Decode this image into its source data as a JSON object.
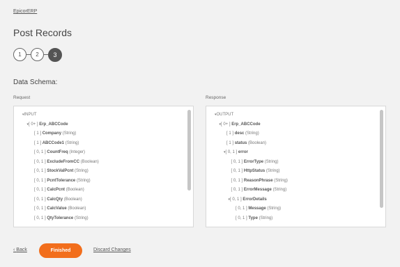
{
  "breadcrumb": "EpicorERP",
  "title": "Post Records",
  "steps": [
    "1",
    "2",
    "3"
  ],
  "current_step": "3",
  "section_title": "Data Schema:",
  "request": {
    "label": "Request",
    "nodes": [
      {
        "indent": 0,
        "toggle": "▾",
        "card": "",
        "name": "INPUT",
        "type": "",
        "bold": false
      },
      {
        "indent": 1,
        "toggle": "▾",
        "card": "[ 0+ ]",
        "name": "Erp_ABCCode",
        "type": "",
        "bold": true
      },
      {
        "indent": 2,
        "toggle": "",
        "card": "[ 1 ]",
        "name": "Company",
        "type": "(String)",
        "bold": true
      },
      {
        "indent": 2,
        "toggle": "",
        "card": "[ 1 ]",
        "name": "ABCCode1",
        "type": "(String)",
        "bold": true
      },
      {
        "indent": 2,
        "toggle": "",
        "card": "[ 0, 1 ]",
        "name": "CountFreq",
        "type": "(Integer)",
        "bold": true
      },
      {
        "indent": 2,
        "toggle": "",
        "card": "[ 0, 1 ]",
        "name": "ExcludeFromCC",
        "type": "(Boolean)",
        "bold": true
      },
      {
        "indent": 2,
        "toggle": "",
        "card": "[ 0, 1 ]",
        "name": "StockValPcnt",
        "type": "(String)",
        "bold": true
      },
      {
        "indent": 2,
        "toggle": "",
        "card": "[ 0, 1 ]",
        "name": "PcntTolerance",
        "type": "(String)",
        "bold": true
      },
      {
        "indent": 2,
        "toggle": "",
        "card": "[ 0, 1 ]",
        "name": "CalcPcnt",
        "type": "(Boolean)",
        "bold": true
      },
      {
        "indent": 2,
        "toggle": "",
        "card": "[ 0, 1 ]",
        "name": "CalcQty",
        "type": "(Boolean)",
        "bold": true
      },
      {
        "indent": 2,
        "toggle": "",
        "card": "[ 0, 1 ]",
        "name": "CalcValue",
        "type": "(Boolean)",
        "bold": true
      },
      {
        "indent": 2,
        "toggle": "",
        "card": "[ 0, 1 ]",
        "name": "QtyTolerance",
        "type": "(String)",
        "bold": true
      }
    ]
  },
  "response": {
    "label": "Response",
    "nodes": [
      {
        "indent": 0,
        "toggle": "▾",
        "card": "",
        "name": "OUTPUT",
        "type": "",
        "bold": false
      },
      {
        "indent": 1,
        "toggle": "▾",
        "card": "[ 0+ ]",
        "name": "Erp_ABCCode",
        "type": "",
        "bold": true
      },
      {
        "indent": 2,
        "toggle": "",
        "card": "[ 1 ]",
        "name": "desc",
        "type": "(String)",
        "bold": true
      },
      {
        "indent": 2,
        "toggle": "",
        "card": "[ 1 ]",
        "name": "status",
        "type": "(Boolean)",
        "bold": true
      },
      {
        "indent": 2,
        "toggle": "▾",
        "card": "[ 0, 1 ]",
        "name": "error",
        "type": "",
        "bold": true
      },
      {
        "indent": 3,
        "toggle": "",
        "card": "[ 0, 1 ]",
        "name": "ErrorType",
        "type": "(String)",
        "bold": true
      },
      {
        "indent": 3,
        "toggle": "",
        "card": "[ 0, 1 ]",
        "name": "HttpStatus",
        "type": "(String)",
        "bold": true
      },
      {
        "indent": 3,
        "toggle": "",
        "card": "[ 0, 1 ]",
        "name": "ReasonPhrase",
        "type": "(String)",
        "bold": true
      },
      {
        "indent": 3,
        "toggle": "",
        "card": "[ 0, 1 ]",
        "name": "ErrorMessage",
        "type": "(String)",
        "bold": true
      },
      {
        "indent": 3,
        "toggle": "▾",
        "card": "[ 0, 1 ]",
        "name": "ErrorDetails",
        "type": "",
        "bold": true
      },
      {
        "indent": 4,
        "toggle": "",
        "card": "[ 0, 1 ]",
        "name": "Message",
        "type": "(String)",
        "bold": true
      },
      {
        "indent": 4,
        "toggle": "",
        "card": "[ 0, 1 ]",
        "name": "Type",
        "type": "(String)",
        "bold": true
      }
    ]
  },
  "footer": {
    "back_label": "Back",
    "finished_label": "Finished",
    "discard_label": "Discard Changes"
  },
  "colors": {
    "accent": "#f26e1c",
    "active_step": "#545454"
  }
}
